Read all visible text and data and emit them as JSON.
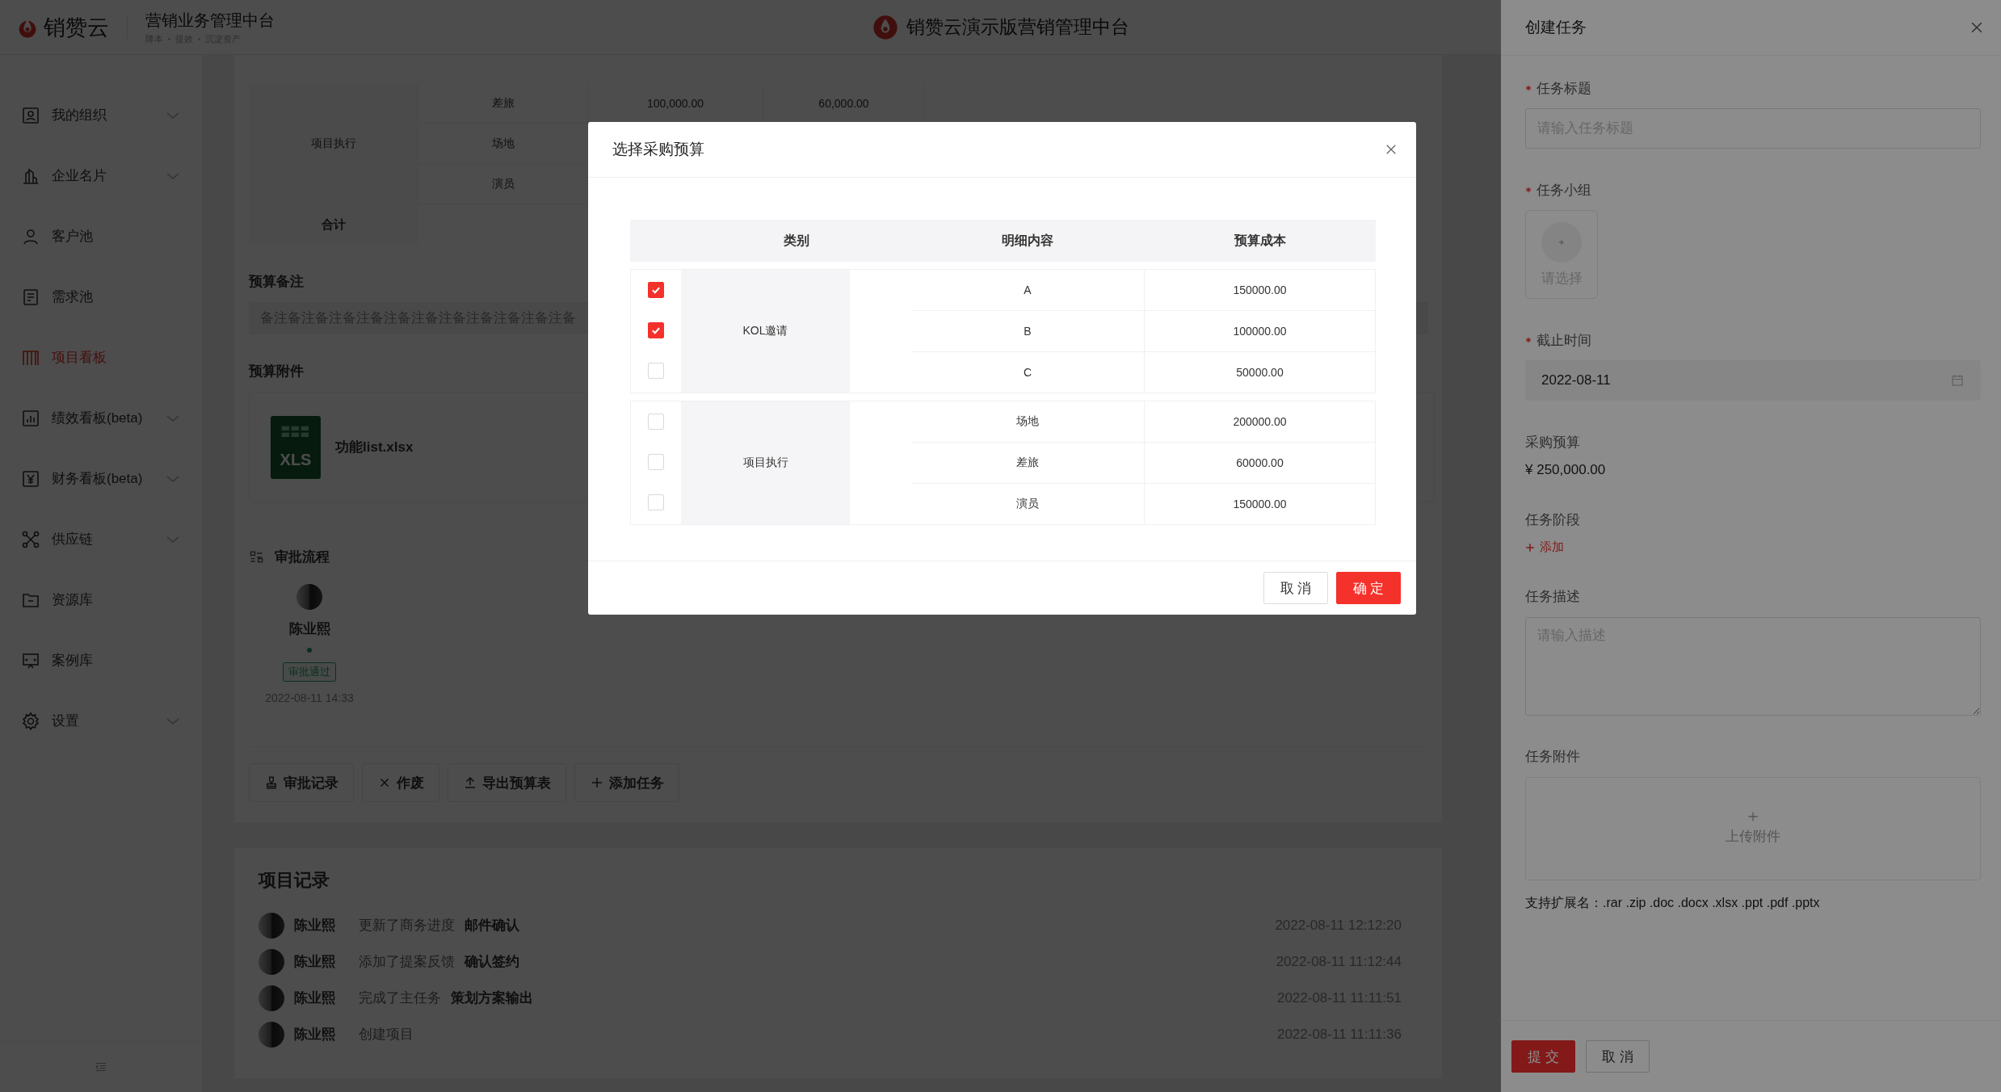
{
  "header": {
    "brand": "销赞云",
    "title": "营销业务管理中台",
    "slogans": [
      "降本",
      "提效",
      "沉淀资产"
    ],
    "center_title": "销赞云演示版营销管理中台"
  },
  "sidebar": {
    "items": [
      {
        "label": "我的组织",
        "expandable": true,
        "selected": false
      },
      {
        "label": "企业名片",
        "expandable": true,
        "selected": false
      },
      {
        "label": "客户池",
        "expandable": false,
        "selected": false
      },
      {
        "label": "需求池",
        "expandable": false,
        "selected": false
      },
      {
        "label": "项目看板",
        "expandable": false,
        "selected": true
      },
      {
        "label": "绩效看板(beta)",
        "expandable": true,
        "selected": false
      },
      {
        "label": "财务看板(beta)",
        "expandable": true,
        "selected": false
      },
      {
        "label": "供应链",
        "expandable": true,
        "selected": false
      },
      {
        "label": "资源库",
        "expandable": false,
        "selected": false
      },
      {
        "label": "案例库",
        "expandable": false,
        "selected": false
      },
      {
        "label": "设置",
        "expandable": true,
        "selected": false
      }
    ]
  },
  "budget_table": {
    "group": "项目执行",
    "rows": [
      {
        "item": "差旅",
        "column_3": "100,000.00",
        "column_4": "60,000.00"
      },
      {
        "item": "场地"
      },
      {
        "item": "演员"
      }
    ],
    "total_label": "合计"
  },
  "remark": {
    "title": "预算备注",
    "text": "备注备注备注备注备注备注备注备注备注备注备注备"
  },
  "attachment": {
    "title": "预算附件",
    "file_badge": "XLS",
    "file_name": "功能list.xlsx"
  },
  "approval": {
    "title": "审批流程",
    "steps": [
      {
        "name": "陈业熙",
        "status": "审批通过",
        "time": "2022-08-11 14:33"
      }
    ]
  },
  "actions": [
    "审批记录",
    "作废",
    "导出预算表",
    "添加任务"
  ],
  "records": {
    "title": "项目记录",
    "items": [
      {
        "user": "陈业熙",
        "action": "更新了商务进度",
        "target": "邮件确认",
        "time": "2022-08-11 12:12:20"
      },
      {
        "user": "陈业熙",
        "action": "添加了提案反馈",
        "target": "确认签约",
        "time": "2022-08-11 11:12:44"
      },
      {
        "user": "陈业熙",
        "action": "完成了主任务",
        "target": "策划方案输出",
        "time": "2022-08-11 11:11:51"
      },
      {
        "user": "陈业熙",
        "action": "创建项目",
        "time": "2022-08-11 11:11:36"
      }
    ]
  },
  "drawer": {
    "title": "创建任务",
    "fields": [
      {
        "kind": "input",
        "label": "任务标题",
        "required": true,
        "placeholder": "请输入任务标题"
      },
      {
        "kind": "picker",
        "label": "任务小组",
        "required": true,
        "button_label": "请选择"
      },
      {
        "kind": "date",
        "label": "截止时间",
        "required": true,
        "value": "2022-08-11"
      },
      {
        "kind": "value",
        "label": "采购预算",
        "required": false,
        "value": "¥ 250,000.00"
      },
      {
        "kind": "add",
        "label": "任务阶段",
        "required": false,
        "link": "添加"
      },
      {
        "kind": "textarea",
        "label": "任务描述",
        "required": false,
        "placeholder": "请输入描述"
      },
      {
        "kind": "upload",
        "label": "任务附件",
        "required": false,
        "button_label": "上传附件",
        "hint": "支持扩展名：.rar .zip .doc .docx .xlsx .ppt .pdf .pptx"
      }
    ],
    "buttons": [
      {
        "label": "提 交",
        "primary": true
      },
      {
        "label": "取 消",
        "primary": false
      }
    ]
  },
  "modal": {
    "title": "选择采购预算",
    "columns": [
      "类别",
      "明细内容",
      "预算成本"
    ],
    "groups": [
      {
        "category": "KOL邀请",
        "rows": [
          {
            "item": "A",
            "cost": "150000.00",
            "checked": true
          },
          {
            "item": "B",
            "cost": "100000.00",
            "checked": true
          },
          {
            "item": "C",
            "cost": "50000.00",
            "checked": false
          }
        ]
      },
      {
        "category": "项目执行",
        "rows": [
          {
            "item": "场地",
            "cost": "200000.00",
            "checked": false
          },
          {
            "item": "差旅",
            "cost": "60000.00",
            "checked": false
          },
          {
            "item": "演员",
            "cost": "150000.00",
            "checked": false
          }
        ]
      }
    ],
    "buttons": [
      {
        "label": "取 消",
        "primary": false
      },
      {
        "label": "确 定",
        "primary": true
      }
    ]
  }
}
